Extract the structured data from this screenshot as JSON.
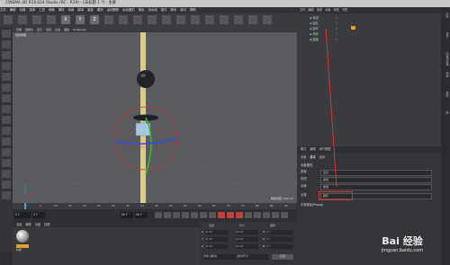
{
  "window": {
    "title": "CINEMA 4D R19.024 Studio (RC - R19) - [未标题 1 *] - 主要"
  },
  "menu": [
    "文件",
    "编辑",
    "创建",
    "选择",
    "工具",
    "网格",
    "捕捉",
    "动画",
    "模拟",
    "渲染",
    "雕刻",
    "运动跟踪",
    "运动图形",
    "角色",
    "流水线",
    "插件",
    "脚本",
    "窗口",
    "帮助"
  ],
  "toolbar": {
    "buttons": [
      "undo-icon",
      "move-icon",
      "scale-icon",
      "rotate-icon",
      "X",
      "Y",
      "Z",
      "axis-icon",
      "render-icon",
      "render-view-icon",
      "render-settings-icon",
      "cube-icon",
      "pen-icon",
      "subdivide-icon",
      "array-icon",
      "deformer-icon",
      "scene-icon",
      "camera-icon",
      "light-icon"
    ]
  },
  "viewport": {
    "menu": [
      "查看",
      "摄像机",
      "显示",
      "选项",
      "过滤",
      "面板",
      "ProRender"
    ],
    "label": "透视视图",
    "grid_info": "网格间距: 100 cm"
  },
  "timeline": {
    "ticks": [
      "0",
      "5",
      "10",
      "15",
      "20",
      "25",
      "30",
      "35",
      "40",
      "45",
      "50",
      "55",
      "60",
      "65",
      "70",
      "75",
      "80",
      "85",
      "90"
    ],
    "current_frame": "0 F",
    "start": "0 F",
    "end": "90 F",
    "end2": "90 F"
  },
  "material": {
    "menu": [
      "创建",
      "编辑",
      "功能",
      "纹理"
    ],
    "item_label": "材质"
  },
  "coords": {
    "headers": [
      "位置",
      "尺寸",
      "旋转"
    ],
    "rows": [
      {
        "axis": "X",
        "pos": "0 cm",
        "size": "0 cm",
        "rot_label": "H",
        "rot": "0 °"
      },
      {
        "axis": "Y",
        "pos": "0 cm",
        "size": "0 cm",
        "rot_label": "P",
        "rot": "0 °"
      },
      {
        "axis": "Z",
        "pos": "0 cm",
        "size": "0 cm",
        "rot_label": "B",
        "rot": "0 °"
      }
    ],
    "mode": "对象 (相对)",
    "size_mode": "绝对尺寸",
    "apply": "应用"
  },
  "objects": {
    "menu": [
      "文件",
      "编辑",
      "查看",
      "对象",
      "标签",
      "书签"
    ],
    "items": [
      "管道",
      "圆柱",
      "圆环",
      "球体",
      "圆锥"
    ]
  },
  "attributes": {
    "tabs": [
      "模式",
      "编辑",
      "用户数据"
    ],
    "object_tab": "对象",
    "basic_tab": "基本",
    "coord_tab": "坐标",
    "section": "对象属性",
    "rows": [
      {
        "label": "类型",
        "value": "显示"
      },
      {
        "label": "材质",
        "value": "类型"
      },
      {
        "label": "对象",
        "value": "类型"
      }
    ],
    "highlight_label": "对象",
    "highlight_value": "圆环",
    "subsection": "平滑着色(Phong)"
  },
  "side_tabs": [
    "对象",
    "场景",
    "内容浏览器",
    "构造",
    "属性",
    "层"
  ],
  "watermark": {
    "main": "Bai 经验",
    "sub": "jingyan.baidu.com"
  },
  "colors": {
    "accent_red": "#e03030",
    "axis_green": "#2fbf2f",
    "axis_blue": "#2f4fe0",
    "selection_red": "#d03030"
  }
}
